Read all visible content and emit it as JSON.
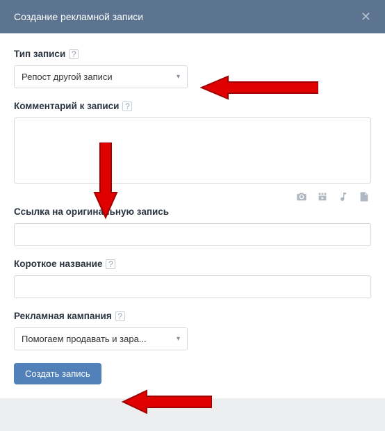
{
  "header": {
    "title": "Создание рекламной записи"
  },
  "fields": {
    "post_type": {
      "label": "Тип записи",
      "value": "Репост другой записи"
    },
    "comment": {
      "label": "Комментарий к записи",
      "value": ""
    },
    "original_link": {
      "label": "Ссылка на оригинальную запись",
      "value": ""
    },
    "short_name": {
      "label": "Короткое название",
      "value": ""
    },
    "campaign": {
      "label": "Рекламная кампания",
      "value": "Помогаем продавать и зара..."
    }
  },
  "actions": {
    "create": "Создать запись"
  },
  "help_glyph": "?"
}
